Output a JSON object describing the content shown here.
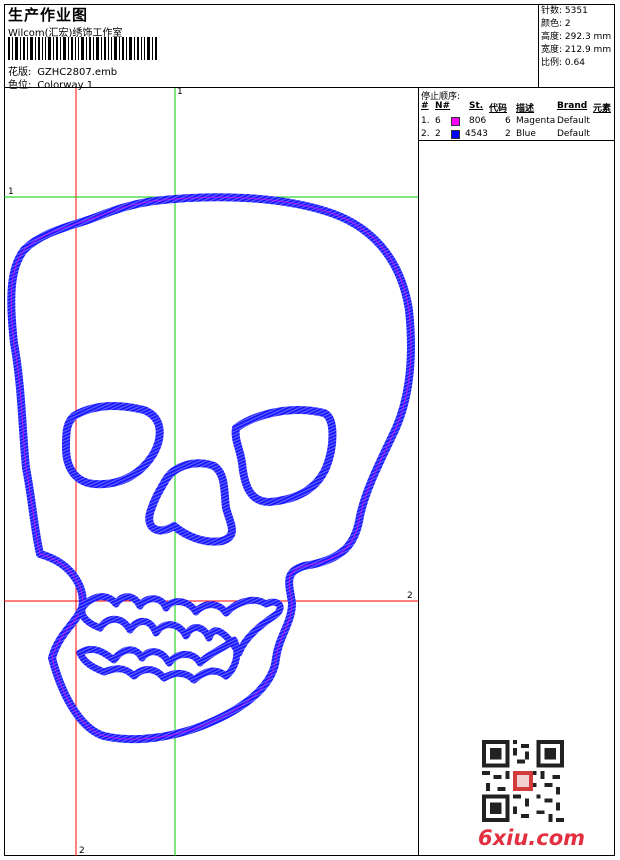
{
  "header": {
    "title": "生产作业图",
    "company": "Wilcom(汇宏)绣饰工作室",
    "design_label": "花版:",
    "design_value": "GZHC2807.emb",
    "colorway_label": "色位:",
    "colorway_value": "Colorway 1"
  },
  "stats": [
    {
      "label": "针数:",
      "value": "5351"
    },
    {
      "label": "颜色:",
      "value": "2"
    },
    {
      "label": "高度:",
      "value": "292.3 mm"
    },
    {
      "label": "宽度:",
      "value": "212.9 mm"
    },
    {
      "label": "比例:",
      "value": "0.64"
    }
  ],
  "stop_sequence": {
    "title": "停止顺序:",
    "columns": [
      "#",
      "N#",
      "St.",
      "代码",
      "描述",
      "Brand",
      "元素"
    ],
    "rows": [
      {
        "num": "1.",
        "n": "6",
        "swatch": "#ff00ff",
        "code": "806",
        "st": "6",
        "desc": "Magenta",
        "brand": "Default"
      },
      {
        "num": "2.",
        "n": "2",
        "swatch": "#0000ff",
        "code": "4543",
        "st": "2",
        "desc": "Blue",
        "brand": "Default"
      }
    ]
  },
  "guides": {
    "v1_label": "1",
    "h1_label": "1",
    "h2_label": "2",
    "v2_label": "2",
    "green": "#00cc00",
    "red": "#ff0000"
  },
  "colors": {
    "stitch_blue": "#1a1aff",
    "stitch_magenta": "#ff00ff"
  },
  "watermark": {
    "logo_text": "6xiu.com",
    "qr_icon": "qr-code-icon"
  }
}
